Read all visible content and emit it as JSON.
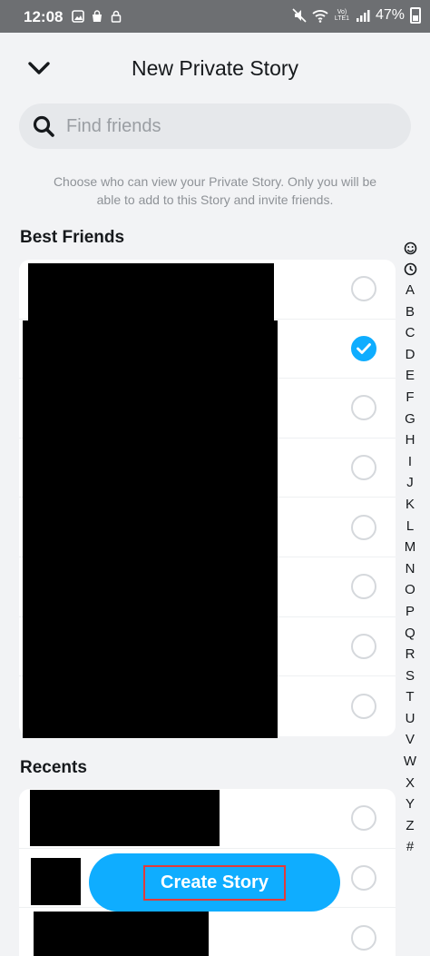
{
  "status_bar": {
    "time": "12:08",
    "network": "Vo) LTE1",
    "battery": "47%"
  },
  "header": {
    "title": "New Private Story"
  },
  "search": {
    "placeholder": "Find friends"
  },
  "description": "Choose who can view your Private Story. Only you will be able to add to this Story and invite friends.",
  "sections": {
    "best_friends": {
      "title": "Best Friends",
      "rows": [
        {
          "selected": false
        },
        {
          "selected": true
        },
        {
          "selected": false
        },
        {
          "selected": false
        },
        {
          "selected": false
        },
        {
          "selected": false
        },
        {
          "selected": false
        },
        {
          "selected": false
        }
      ]
    },
    "recents": {
      "title": "Recents",
      "rows": [
        {
          "selected": false
        },
        {
          "selected": false
        },
        {
          "selected": false
        }
      ]
    }
  },
  "alphabet_index": [
    "A",
    "B",
    "C",
    "D",
    "E",
    "F",
    "G",
    "H",
    "I",
    "J",
    "K",
    "L",
    "M",
    "N",
    "O",
    "P",
    "Q",
    "R",
    "S",
    "T",
    "U",
    "V",
    "W",
    "X",
    "Y",
    "Z",
    "#"
  ],
  "create_button": {
    "label": "Create Story"
  },
  "colors": {
    "accent": "#0fadff",
    "highlight_box": "#e23b3b",
    "status_bar": "#6d6f72"
  }
}
